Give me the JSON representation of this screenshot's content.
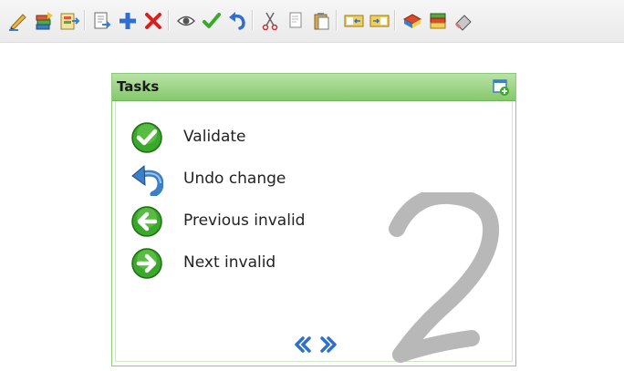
{
  "toolbar": {
    "buttons": [
      {
        "name": "pen-icon"
      },
      {
        "name": "import-books-icon"
      },
      {
        "name": "export-books-icon"
      },
      {
        "name": "document-arrow-icon"
      },
      {
        "name": "add-icon"
      },
      {
        "name": "delete-icon"
      },
      {
        "name": "view-eye-icon"
      },
      {
        "name": "validate-check-icon"
      },
      {
        "name": "undo-icon"
      },
      {
        "name": "cut-icon"
      },
      {
        "name": "copy-icon"
      },
      {
        "name": "paste-icon"
      },
      {
        "name": "field-left-icon"
      },
      {
        "name": "field-right-icon"
      },
      {
        "name": "book-red-icon"
      },
      {
        "name": "book-stack-icon"
      },
      {
        "name": "eraser-icon"
      }
    ]
  },
  "tasks_panel": {
    "title": "Tasks",
    "big_number": "2",
    "items": [
      {
        "label": "Validate",
        "icon": "check-circle-icon",
        "color": "#34a822"
      },
      {
        "label": "Undo change",
        "icon": "undo-arrow-icon",
        "color": "#3a7fc8"
      },
      {
        "label": "Previous invalid",
        "icon": "arrow-left-circle-icon",
        "color": "#34a822"
      },
      {
        "label": "Next invalid",
        "icon": "arrow-right-circle-icon",
        "color": "#34a822"
      }
    ],
    "pager": {
      "prev_icon": "double-chevron-left-icon",
      "next_icon": "double-chevron-right-icon"
    }
  },
  "colors": {
    "accent_green": "#86c86c",
    "border_green": "#8fc97d",
    "pager_blue": "#2f6fd0",
    "watermark_gray": "#b8b8b8"
  }
}
